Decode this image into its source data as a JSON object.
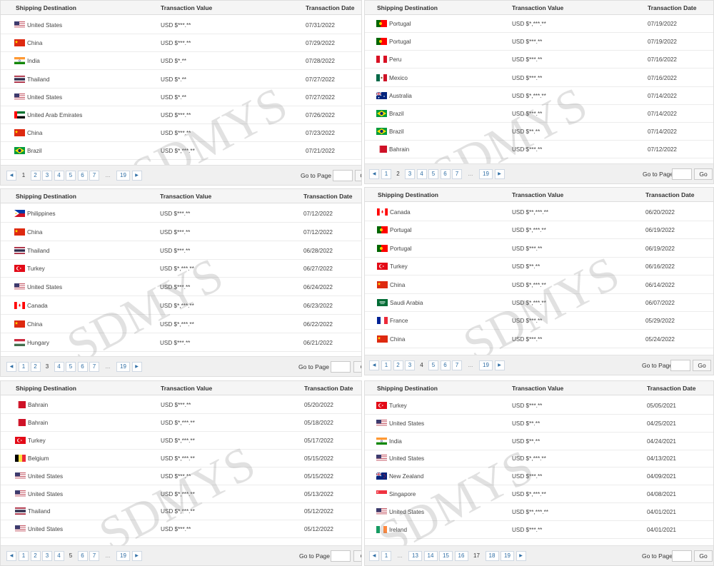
{
  "headers": {
    "destination": "Shipping Destination",
    "value": "Transaction Value",
    "date": "Transaction Date"
  },
  "pager": {
    "goto_label": "Go to Page",
    "go_label": "Go",
    "dots": "...",
    "prev_icon": "caret-left-icon",
    "next_icon": "caret-right-icon"
  },
  "watermark": "SDMYS",
  "panels": [
    {
      "rows": [
        {
          "country": "United States",
          "flag": "us",
          "value": "USD $***.**",
          "date": "07/31/2022"
        },
        {
          "country": "China",
          "flag": "cn",
          "value": "USD $***.**",
          "date": "07/29/2022"
        },
        {
          "country": "India",
          "flag": "in",
          "value": "USD $*.**",
          "date": "07/28/2022"
        },
        {
          "country": "Thailand",
          "flag": "th",
          "value": "USD $*.**",
          "date": "07/27/2022"
        },
        {
          "country": "United States",
          "flag": "us",
          "value": "USD $*.**",
          "date": "07/27/2022"
        },
        {
          "country": "United Arab Emirates",
          "flag": "ae",
          "value": "USD $***.**",
          "date": "07/26/2022"
        },
        {
          "country": "China",
          "flag": "cn",
          "value": "USD $***.**",
          "date": "07/23/2022"
        },
        {
          "country": "Brazil",
          "flag": "br",
          "value": "USD $*,***.**",
          "date": "07/21/2022"
        }
      ],
      "pages": [
        "1",
        "2",
        "3",
        "4",
        "5",
        "6",
        "7",
        "...",
        "19"
      ],
      "current_page": "1",
      "go_label": "Go"
    },
    {
      "rows": [
        {
          "country": "Portugal",
          "flag": "pt",
          "value": "USD $*,***.**",
          "date": "07/19/2022"
        },
        {
          "country": "Portugal",
          "flag": "pt",
          "value": "USD $***.**",
          "date": "07/19/2022"
        },
        {
          "country": "Peru",
          "flag": "pe",
          "value": "USD $***.**",
          "date": "07/16/2022"
        },
        {
          "country": "Mexico",
          "flag": "mx",
          "value": "USD $***.**",
          "date": "07/16/2022"
        },
        {
          "country": "Australia",
          "flag": "au",
          "value": "USD $*,***.**",
          "date": "07/14/2022"
        },
        {
          "country": "Brazil",
          "flag": "br",
          "value": "USD $***.**",
          "date": "07/14/2022"
        },
        {
          "country": "Brazil",
          "flag": "br",
          "value": "USD $**.**",
          "date": "07/14/2022"
        },
        {
          "country": "Bahrain",
          "flag": "bh",
          "value": "USD $***.**",
          "date": "07/12/2022"
        }
      ],
      "pages": [
        "1",
        "2",
        "3",
        "4",
        "5",
        "6",
        "7",
        "...",
        "19"
      ],
      "current_page": "2",
      "go_label": "Go"
    },
    {
      "rows": [
        {
          "country": "Philippines",
          "flag": "ph",
          "value": "USD $***.**",
          "date": "07/12/2022"
        },
        {
          "country": "China",
          "flag": "cn",
          "value": "USD $***.**",
          "date": "07/12/2022"
        },
        {
          "country": "Thailand",
          "flag": "th",
          "value": "USD $***.**",
          "date": "06/28/2022"
        },
        {
          "country": "Turkey",
          "flag": "tr",
          "value": "USD $*,***.**",
          "date": "06/27/2022"
        },
        {
          "country": "United States",
          "flag": "us",
          "value": "USD $***.**",
          "date": "06/24/2022"
        },
        {
          "country": "Canada",
          "flag": "ca",
          "value": "USD $*,***.**",
          "date": "06/23/2022"
        },
        {
          "country": "China",
          "flag": "cn",
          "value": "USD $*,***.**",
          "date": "06/22/2022"
        },
        {
          "country": "Hungary",
          "flag": "hu",
          "value": "USD $***.**",
          "date": "06/21/2022"
        }
      ],
      "pages": [
        "1",
        "2",
        "3",
        "4",
        "5",
        "6",
        "7",
        "...",
        "19"
      ],
      "current_page": "3",
      "go_label": "G"
    },
    {
      "rows": [
        {
          "country": "Canada",
          "flag": "ca",
          "value": "USD $**,***.**",
          "date": "06/20/2022"
        },
        {
          "country": "Portugal",
          "flag": "pt",
          "value": "USD $*,***.**",
          "date": "06/19/2022"
        },
        {
          "country": "Portugal",
          "flag": "pt",
          "value": "USD $***.**",
          "date": "06/19/2022"
        },
        {
          "country": "Turkey",
          "flag": "tr",
          "value": "USD $**.**",
          "date": "06/16/2022"
        },
        {
          "country": "China",
          "flag": "cn",
          "value": "USD $*,***.**",
          "date": "06/14/2022"
        },
        {
          "country": "Saudi Arabia",
          "flag": "sa",
          "value": "USD $*,***.**",
          "date": "06/07/2022"
        },
        {
          "country": "France",
          "flag": "fr",
          "value": "USD $***.**",
          "date": "05/29/2022"
        },
        {
          "country": "China",
          "flag": "cn",
          "value": "USD $***.**",
          "date": "05/24/2022"
        }
      ],
      "pages": [
        "1",
        "2",
        "3",
        "4",
        "5",
        "6",
        "7",
        "...",
        "19"
      ],
      "current_page": "4",
      "go_label": "Go"
    },
    {
      "rows": [
        {
          "country": "Bahrain",
          "flag": "bh",
          "value": "USD $***.**",
          "date": "05/20/2022"
        },
        {
          "country": "Bahrain",
          "flag": "bh",
          "value": "USD $*,***.**",
          "date": "05/18/2022"
        },
        {
          "country": "Turkey",
          "flag": "tr",
          "value": "USD $*,***.**",
          "date": "05/17/2022"
        },
        {
          "country": "Belgium",
          "flag": "be",
          "value": "USD $*,***.**",
          "date": "05/15/2022"
        },
        {
          "country": "United States",
          "flag": "us",
          "value": "USD $***.**",
          "date": "05/15/2022"
        },
        {
          "country": "United States",
          "flag": "us",
          "value": "USD $*,***.**",
          "date": "05/13/2022"
        },
        {
          "country": "Thailand",
          "flag": "th",
          "value": "USD $*,***.**",
          "date": "05/12/2022"
        },
        {
          "country": "United States",
          "flag": "us",
          "value": "USD $***.**",
          "date": "05/12/2022"
        }
      ],
      "pages": [
        "1",
        "2",
        "3",
        "4",
        "5",
        "6",
        "7",
        "...",
        "19"
      ],
      "current_page": "5",
      "go_label": "G"
    },
    {
      "rows": [
        {
          "country": "Turkey",
          "flag": "tr",
          "value": "USD $***.**",
          "date": "05/05/2021"
        },
        {
          "country": "United States",
          "flag": "us",
          "value": "USD $**.**",
          "date": "04/25/2021"
        },
        {
          "country": "India",
          "flag": "in",
          "value": "USD $**.**",
          "date": "04/24/2021"
        },
        {
          "country": "United States",
          "flag": "us",
          "value": "USD $*,***.**",
          "date": "04/13/2021"
        },
        {
          "country": "New Zealand",
          "flag": "nz",
          "value": "USD $***.**",
          "date": "04/09/2021"
        },
        {
          "country": "Singapore",
          "flag": "sg",
          "value": "USD $*,***.**",
          "date": "04/08/2021"
        },
        {
          "country": "United States",
          "flag": "us",
          "value": "USD $**,***.**",
          "date": "04/01/2021"
        },
        {
          "country": "Ireland",
          "flag": "ie",
          "value": "USD $***.**",
          "date": "04/01/2021"
        }
      ],
      "pages": [
        "1",
        "...",
        "13",
        "14",
        "15",
        "16",
        "17",
        "18",
        "19"
      ],
      "current_page": "17",
      "go_label": "Go"
    }
  ],
  "colors": {
    "link": "#2f6ea5",
    "header_bg": "#f5f5f5",
    "pager_bg": "#f0f0f0"
  }
}
